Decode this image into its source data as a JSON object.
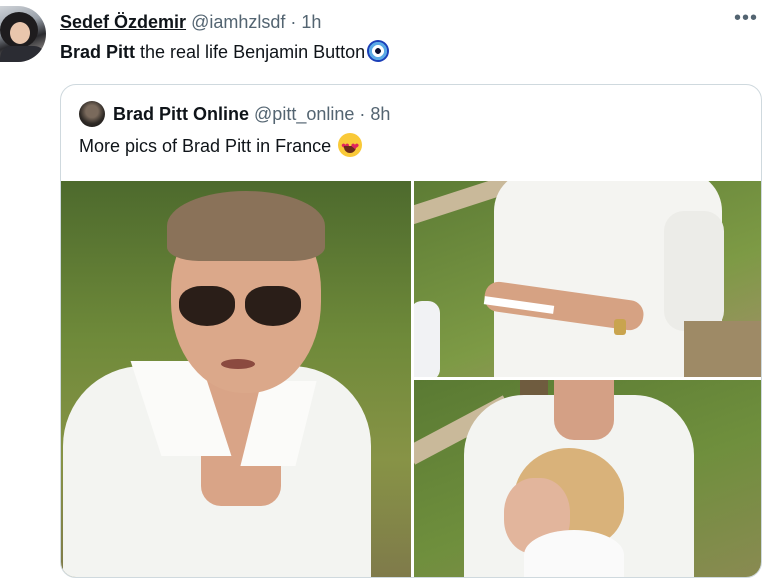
{
  "tweet": {
    "author_name": "Sedef Özdemir",
    "handle": "@iamhzlsdf",
    "separator": "·",
    "time": "1h",
    "more_label": "•••",
    "text_bold": "Brad Pitt",
    "text_rest": " the real life Benjamin Button",
    "emoji": "nazar-amulet"
  },
  "quote": {
    "author_name": "Brad Pitt Online",
    "handle": "@pitt_online",
    "separator": "·",
    "time": "8h",
    "text": "More pics of Brad Pitt in France",
    "emoji": "smiling-face-with-heart-eyes"
  },
  "media": {
    "count": 3,
    "photos": [
      "close-up portrait",
      "holding paper",
      "with woman"
    ]
  },
  "colors": {
    "text": "#0f1419",
    "secondary": "#536471",
    "border": "#cfd9de"
  }
}
